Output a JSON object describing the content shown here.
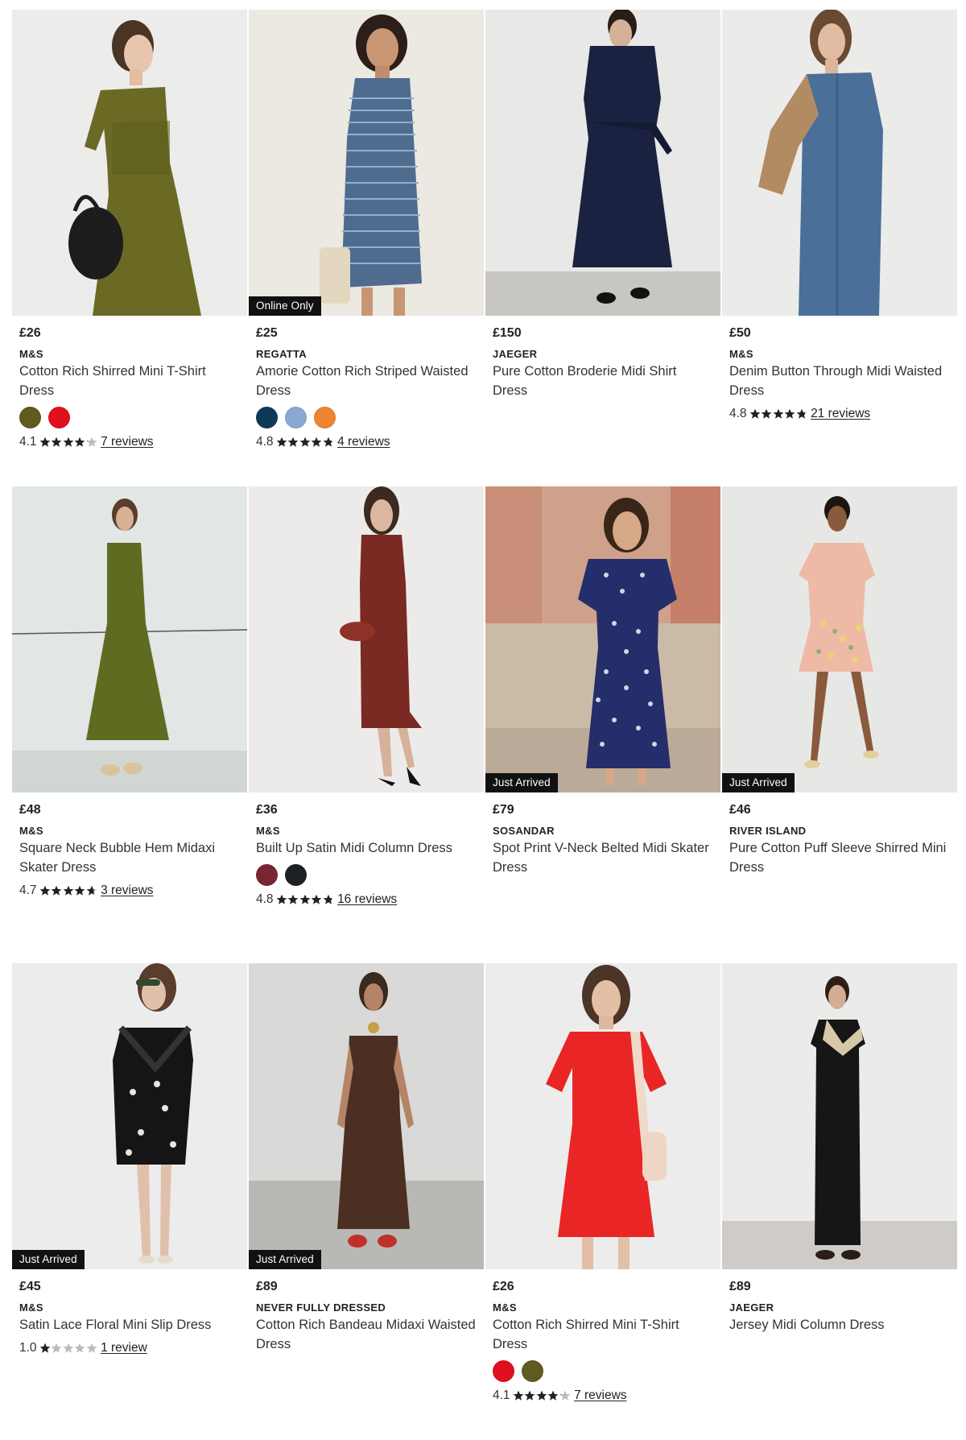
{
  "colors": {
    "badge_bg": "#111111",
    "star_filled": "#222222",
    "star_empty": "#bbbbbb"
  },
  "products": [
    {
      "price": "£26",
      "brand": "M&S",
      "name": "Cotton Rich Shirred Mini T-Shirt Dress",
      "badge": "",
      "swatches": [
        "#5f5a1f",
        "#e0101f"
      ],
      "rating_value": "4.1",
      "rating": 4.1,
      "reviews": "7 reviews"
    },
    {
      "price": "£25",
      "brand": "REGATTA",
      "name": "Amorie Cotton Rich Striped Waisted Dress",
      "badge": "Online Only",
      "swatches": [
        "#0e3a57",
        "#8aa8d0",
        "#ee8330"
      ],
      "rating_value": "4.8",
      "rating": 4.8,
      "reviews": "4 reviews"
    },
    {
      "price": "£150",
      "brand": "JAEGER",
      "name": "Pure Cotton Broderie Midi Shirt Dress",
      "badge": "",
      "swatches": [],
      "rating_value": "",
      "rating": 0,
      "reviews": ""
    },
    {
      "price": "£50",
      "brand": "M&S",
      "name": "Denim Button Through Midi Waisted Dress",
      "badge": "",
      "swatches": [],
      "rating_value": "4.8",
      "rating": 4.8,
      "reviews": "21 reviews"
    },
    {
      "price": "£48",
      "brand": "M&S",
      "name": "Square Neck Bubble Hem Midaxi Skater Dress",
      "badge": "",
      "swatches": [],
      "rating_value": "4.7",
      "rating": 4.7,
      "reviews": "3 reviews"
    },
    {
      "price": "£36",
      "brand": "M&S",
      "name": "Built Up Satin Midi Column Dress",
      "badge": "",
      "swatches": [
        "#7a2630",
        "#1d2124"
      ],
      "rating_value": "4.8",
      "rating": 4.8,
      "reviews": "16 reviews"
    },
    {
      "price": "£79",
      "brand": "SOSANDAR",
      "name": "Spot Print V-Neck Belted Midi Skater Dress",
      "badge": "Just Arrived",
      "swatches": [],
      "rating_value": "",
      "rating": 0,
      "reviews": ""
    },
    {
      "price": "£46",
      "brand": "RIVER ISLAND",
      "name": "Pure Cotton Puff Sleeve Shirred Mini Dress",
      "badge": "Just Arrived",
      "swatches": [],
      "rating_value": "",
      "rating": 0,
      "reviews": ""
    },
    {
      "price": "£45",
      "brand": "M&S",
      "name": "Satin Lace Floral Mini Slip Dress",
      "badge": "Just Arrived",
      "swatches": [],
      "rating_value": "1.0",
      "rating": 1.0,
      "reviews": "1 review"
    },
    {
      "price": "£89",
      "brand": "NEVER FULLY DRESSED",
      "name": "Cotton Rich Bandeau Midaxi Waisted Dress",
      "badge": "Just Arrived",
      "swatches": [],
      "rating_value": "",
      "rating": 0,
      "reviews": ""
    },
    {
      "price": "£26",
      "brand": "M&S",
      "name": "Cotton Rich Shirred Mini T-Shirt Dress",
      "badge": "",
      "swatches": [
        "#e0101f",
        "#5f5a1f"
      ],
      "rating_value": "4.1",
      "rating": 4.1,
      "reviews": "7 reviews"
    },
    {
      "price": "£89",
      "brand": "JAEGER",
      "name": "Jersey Midi Column Dress",
      "badge": "",
      "swatches": [],
      "rating_value": "",
      "rating": 0,
      "reviews": ""
    }
  ]
}
